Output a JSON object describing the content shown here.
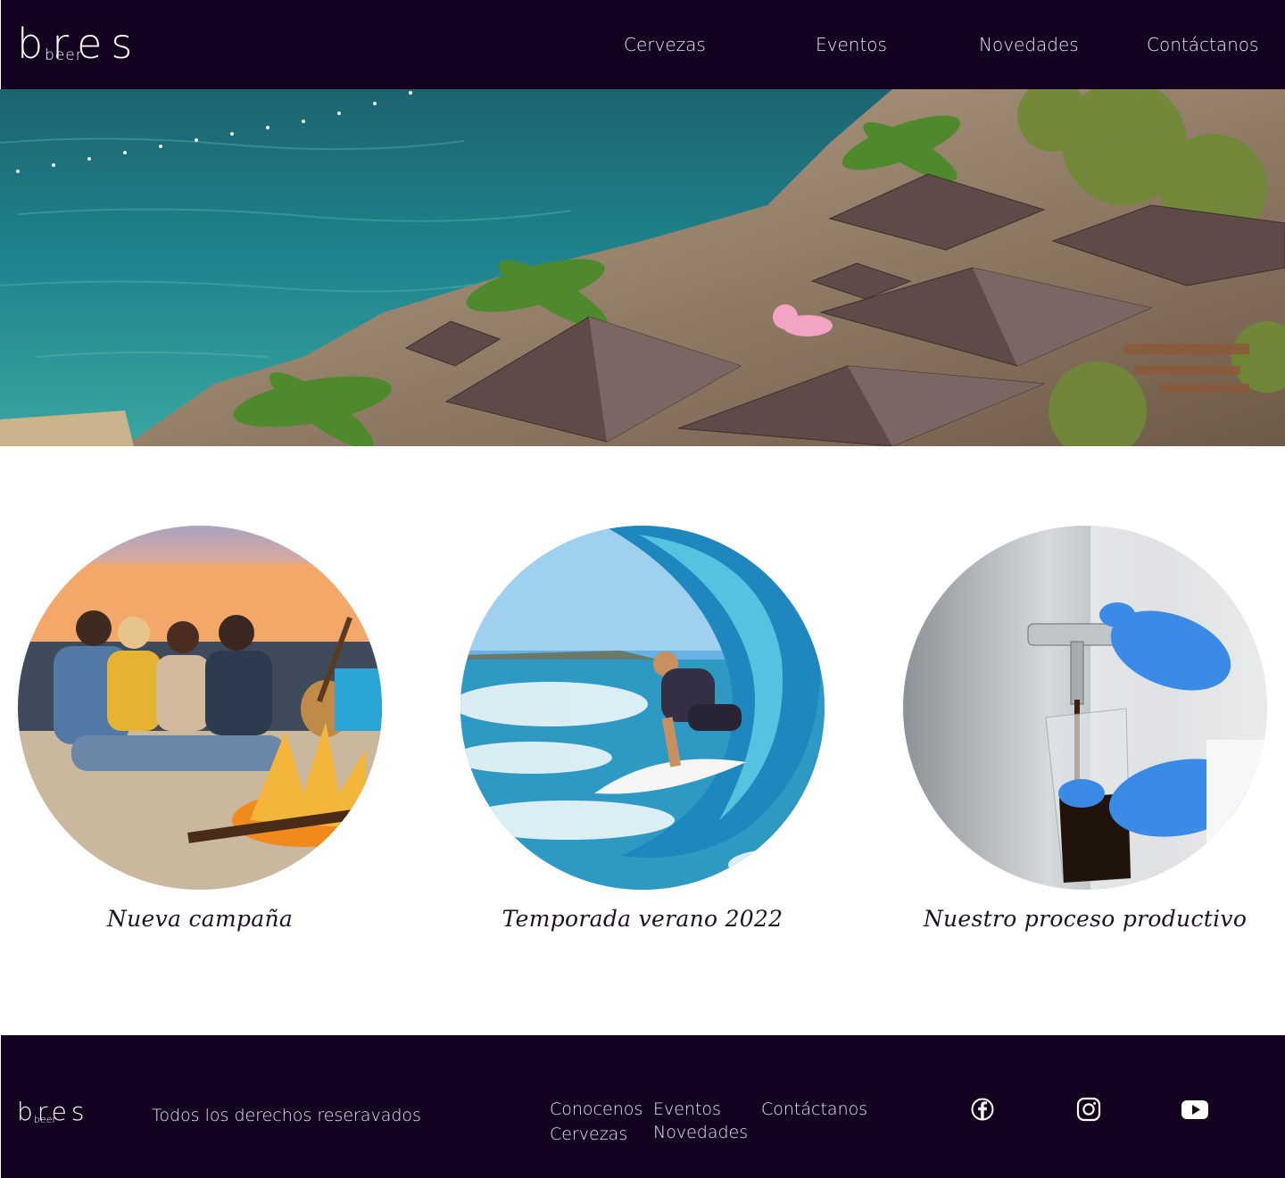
{
  "brand": {
    "name": "bres",
    "sub": "beer"
  },
  "nav": {
    "cervezas": "Cervezas",
    "eventos": "Eventos",
    "novedades": "Novedades",
    "contactanos": "Contáctanos"
  },
  "cards": [
    {
      "caption": "Nueva campaña",
      "icon": "campfire-friends-image"
    },
    {
      "caption": "Temporada verano 2022",
      "icon": "surfer-wave-image"
    },
    {
      "caption": "Nuestro proceso productivo",
      "icon": "beer-tap-image"
    }
  ],
  "footer": {
    "copyright": "Todos los derechos reseravados",
    "links": {
      "conocenos": "Conocenos",
      "cervezas": "Cervezas",
      "eventos": "Eventos",
      "novedades": "Novedades",
      "contactanos": "Contáctanos"
    },
    "social": [
      "facebook-icon",
      "instagram-icon",
      "youtube-icon"
    ]
  },
  "colors": {
    "dark": "#13011f",
    "text_light": "#e9e6ee"
  }
}
